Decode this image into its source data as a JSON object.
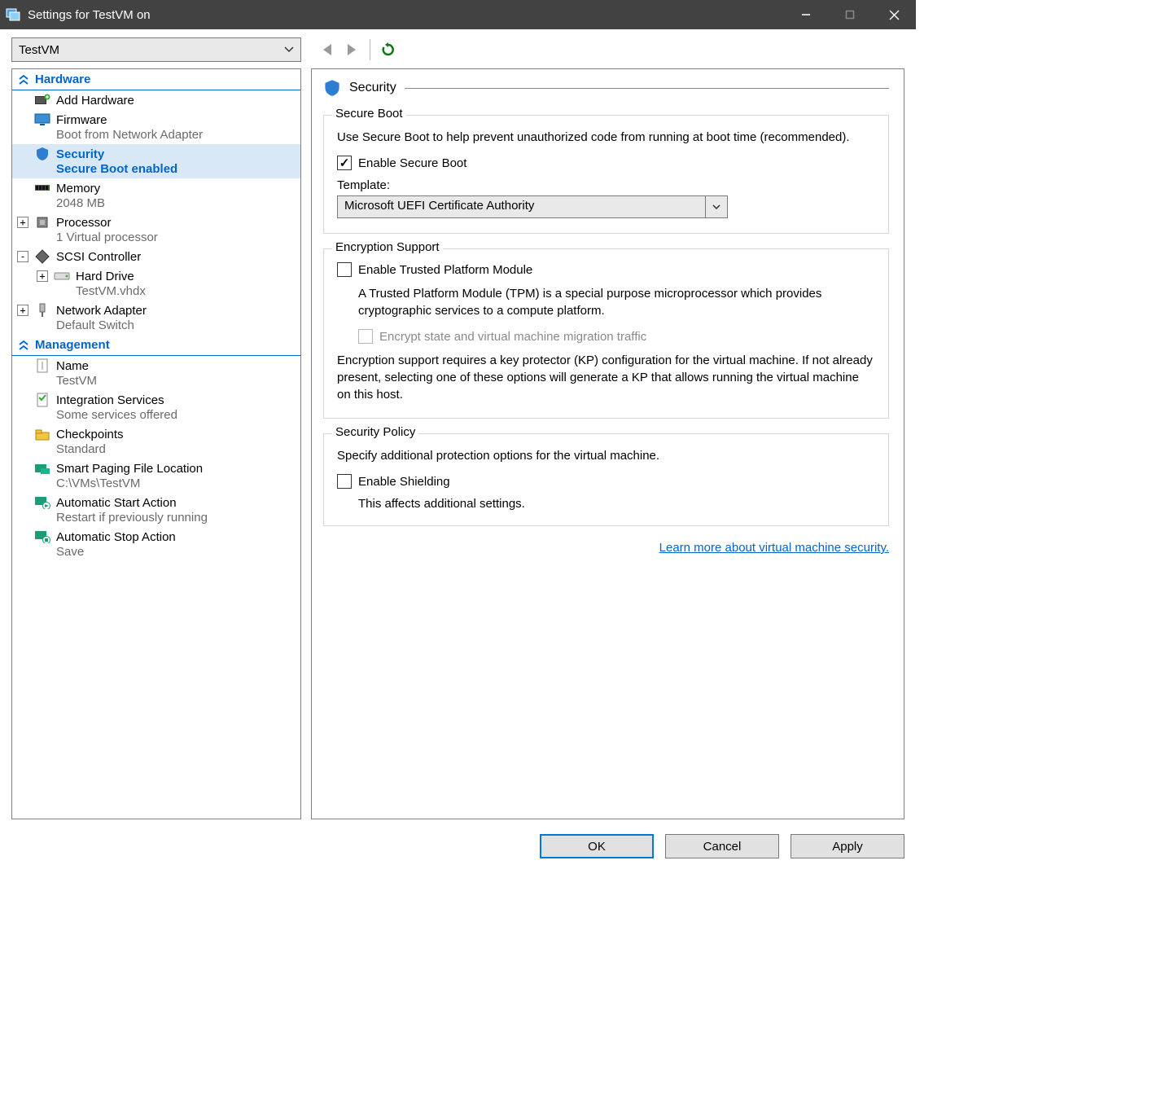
{
  "window": {
    "title": "Settings for TestVM on"
  },
  "toolbar": {
    "vm_name": "TestVM"
  },
  "sidebar": {
    "section_hardware": "Hardware",
    "section_management": "Management",
    "items": {
      "add_hardware": {
        "label": "Add Hardware"
      },
      "firmware": {
        "label": "Firmware",
        "sub": "Boot from Network Adapter"
      },
      "security": {
        "label": "Security",
        "sub": "Secure Boot enabled"
      },
      "memory": {
        "label": "Memory",
        "sub": "2048 MB"
      },
      "processor": {
        "label": "Processor",
        "sub": "1 Virtual processor"
      },
      "scsi": {
        "label": "SCSI Controller"
      },
      "harddrive": {
        "label": "Hard Drive",
        "sub": "TestVM.vhdx"
      },
      "network": {
        "label": "Network Adapter",
        "sub": "Default Switch"
      },
      "name": {
        "label": "Name",
        "sub": "TestVM"
      },
      "integration": {
        "label": "Integration Services",
        "sub": "Some services offered"
      },
      "checkpoints": {
        "label": "Checkpoints",
        "sub": "Standard"
      },
      "smartpaging": {
        "label": "Smart Paging File Location",
        "sub": "C:\\VMs\\TestVM"
      },
      "autostart": {
        "label": "Automatic Start Action",
        "sub": "Restart if previously running"
      },
      "autostop": {
        "label": "Automatic Stop Action",
        "sub": "Save"
      }
    }
  },
  "content": {
    "title": "Security",
    "secure_boot": {
      "legend": "Secure Boot",
      "desc": "Use Secure Boot to help prevent unauthorized code from running at boot time (recommended).",
      "checkbox_label": "Enable Secure Boot",
      "checked": true,
      "template_label": "Template:",
      "template_value": "Microsoft UEFI Certificate Authority"
    },
    "encryption": {
      "legend": "Encryption Support",
      "tpm_label": "Enable Trusted Platform Module",
      "tpm_checked": false,
      "tpm_desc": "A Trusted Platform Module (TPM) is a special purpose microprocessor which provides cryptographic services to a compute platform.",
      "encrypt_traffic_label": "Encrypt state and virtual machine migration traffic",
      "encrypt_traffic_checked": false,
      "note": "Encryption support requires a key protector (KP) configuration for the virtual machine. If not already present, selecting one of these options will generate a KP that allows running the virtual machine on this host."
    },
    "policy": {
      "legend": "Security Policy",
      "desc": "Specify additional protection options for the virtual machine.",
      "shielding_label": "Enable Shielding",
      "shielding_checked": false,
      "shielding_note": "This affects additional settings."
    },
    "link": "Learn more about virtual machine security."
  },
  "buttons": {
    "ok": "OK",
    "cancel": "Cancel",
    "apply": "Apply"
  }
}
